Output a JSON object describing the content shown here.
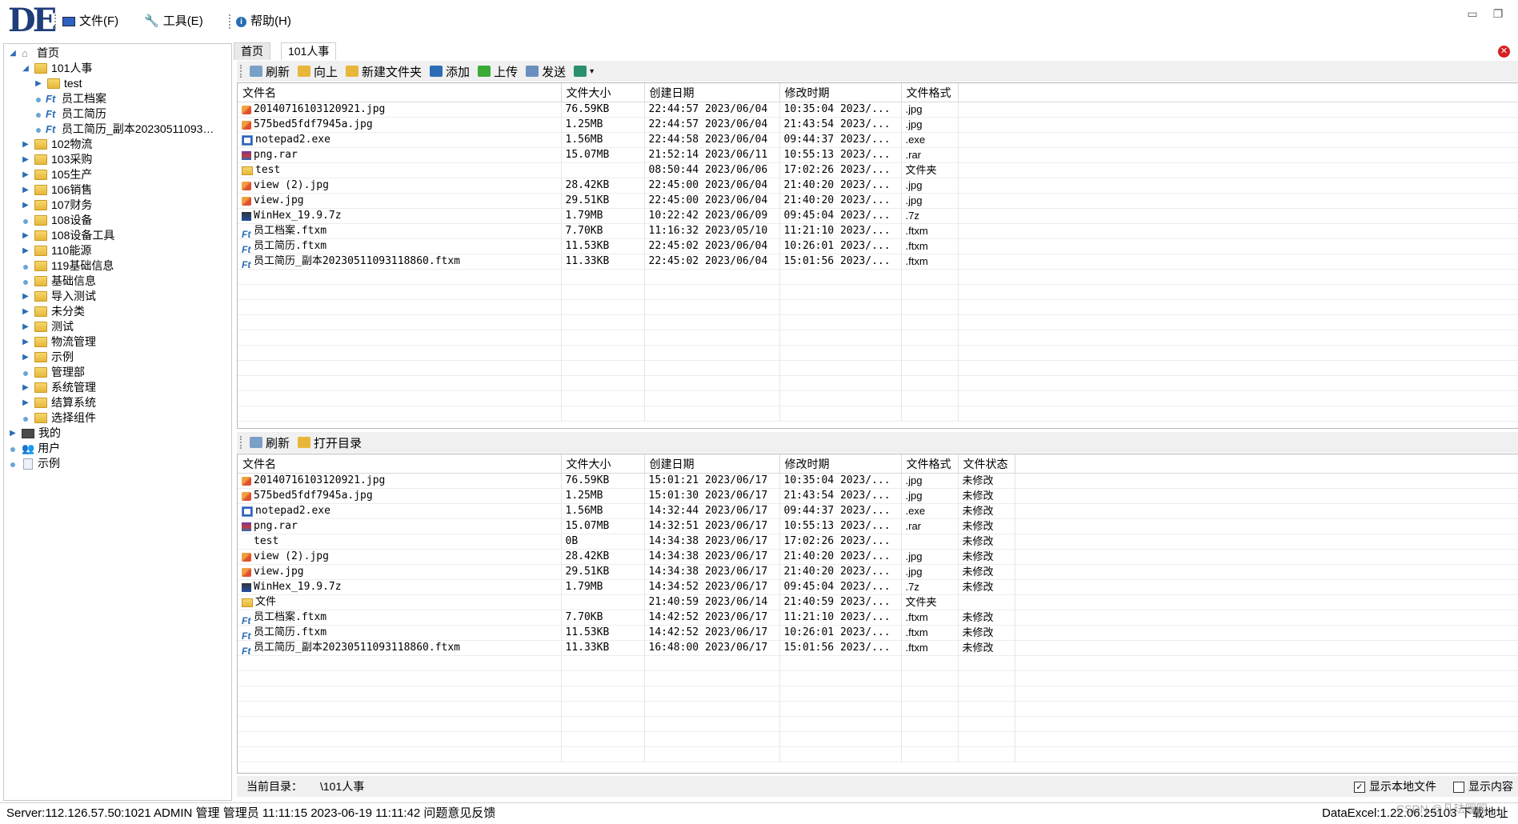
{
  "app": {
    "logo_text": "DE",
    "menu": [
      {
        "label": "文件(F)",
        "icon": "monitor-icon"
      },
      {
        "label": "工具(E)",
        "icon": "wrench-icon"
      },
      {
        "label": "帮助(H)",
        "icon": "info-icon"
      }
    ]
  },
  "tree": {
    "root": "首页",
    "items": [
      {
        "label": "101人事",
        "level": 1,
        "expanded": true,
        "type": "folder"
      },
      {
        "label": "test",
        "level": 2,
        "type": "folder",
        "expandable": true
      },
      {
        "label": "员工档案",
        "level": 2,
        "type": "ft"
      },
      {
        "label": "员工简历",
        "level": 2,
        "type": "ft"
      },
      {
        "label": "员工简历_副本20230511093…",
        "level": 2,
        "type": "ft"
      },
      {
        "label": "102物流",
        "level": 1,
        "type": "folder",
        "expandable": true
      },
      {
        "label": "103采购",
        "level": 1,
        "type": "folder",
        "expandable": true
      },
      {
        "label": "105生产",
        "level": 1,
        "type": "folder",
        "expandable": true
      },
      {
        "label": "106销售",
        "level": 1,
        "type": "folder",
        "expandable": true
      },
      {
        "label": "107财务",
        "level": 1,
        "type": "folder",
        "expandable": true
      },
      {
        "label": "108设备",
        "level": 1,
        "type": "folder",
        "expandable": false
      },
      {
        "label": "108设备工具",
        "level": 1,
        "type": "folder",
        "expandable": true
      },
      {
        "label": "110能源",
        "level": 1,
        "type": "folder",
        "expandable": true
      },
      {
        "label": "119基础信息",
        "level": 1,
        "type": "folder",
        "expandable": false
      },
      {
        "label": "基础信息",
        "level": 1,
        "type": "folder",
        "expandable": false
      },
      {
        "label": "导入测试",
        "level": 1,
        "type": "folder",
        "expandable": true
      },
      {
        "label": "未分类",
        "level": 1,
        "type": "folder",
        "expandable": true
      },
      {
        "label": "测试",
        "level": 1,
        "type": "folder",
        "expandable": true
      },
      {
        "label": "物流管理",
        "level": 1,
        "type": "folder",
        "expandable": true
      },
      {
        "label": "示例",
        "level": 1,
        "type": "folder",
        "expandable": true
      },
      {
        "label": "管理部",
        "level": 1,
        "type": "folder",
        "expandable": false
      },
      {
        "label": "系统管理",
        "level": 1,
        "type": "folder",
        "expandable": true
      },
      {
        "label": "结算系统",
        "level": 1,
        "type": "folder",
        "expandable": true
      },
      {
        "label": "选择组件",
        "level": 1,
        "type": "folder",
        "expandable": false
      },
      {
        "label": "我的",
        "level": 0,
        "type": "pc",
        "expandable": true
      },
      {
        "label": "用户",
        "level": 0,
        "type": "user",
        "expandable": false
      },
      {
        "label": "示例",
        "level": 0,
        "type": "doc",
        "expandable": false
      }
    ]
  },
  "tabs": [
    {
      "label": "首页"
    },
    {
      "label": "101人事"
    }
  ],
  "toolbar_top": [
    {
      "label": "刷新",
      "icon": "refresh-icon",
      "color": "#7aa0c8"
    },
    {
      "label": "向上",
      "icon": "folder-up-icon",
      "color": "#e7b73a"
    },
    {
      "label": "新建文件夹",
      "icon": "new-folder-icon",
      "color": "#e7b73a"
    },
    {
      "label": "添加",
      "icon": "plus-icon",
      "color": "#2a6db5"
    },
    {
      "label": "上传",
      "icon": "upload-arrow-icon",
      "color": "#3aaa35"
    },
    {
      "label": "发送",
      "icon": "send-mail-icon",
      "color": "#6a8fbf"
    },
    {
      "label": "",
      "icon": "image-dropdown-icon",
      "color": "#2a8f6f"
    }
  ],
  "server_grid": {
    "columns": [
      "文件名",
      "文件大小",
      "创建日期",
      "修改时期",
      "文件格式"
    ],
    "rows": [
      {
        "icon": "jpg",
        "name": "20140716103120921.jpg",
        "size": "76.59KB",
        "created": "22:44:57 2023/06/04",
        "modified": "10:35:04 2023/...",
        "format": ".jpg"
      },
      {
        "icon": "jpg",
        "name": "575bed5fdf7945a.jpg",
        "size": "1.25MB",
        "created": "22:44:57 2023/06/04",
        "modified": "21:43:54 2023/...",
        "format": ".jpg"
      },
      {
        "icon": "exe",
        "name": "notepad2.exe",
        "size": "1.56MB",
        "created": "22:44:58 2023/06/04",
        "modified": "09:44:37 2023/...",
        "format": ".exe"
      },
      {
        "icon": "rar",
        "name": "png.rar",
        "size": "15.07MB",
        "created": "21:52:14 2023/06/11",
        "modified": "10:55:13 2023/...",
        "format": ".rar"
      },
      {
        "icon": "folder",
        "name": "test",
        "size": "",
        "created": "08:50:44 2023/06/06",
        "modified": "17:02:26 2023/...",
        "format": "文件夹"
      },
      {
        "icon": "jpg",
        "name": "view (2).jpg",
        "size": "28.42KB",
        "created": "22:45:00 2023/06/04",
        "modified": "21:40:20 2023/...",
        "format": ".jpg"
      },
      {
        "icon": "jpg",
        "name": "view.jpg",
        "size": "29.51KB",
        "created": "22:45:00 2023/06/04",
        "modified": "21:40:20 2023/...",
        "format": ".jpg"
      },
      {
        "icon": "7z",
        "name": "WinHex_19.9.7z",
        "size": "1.79MB",
        "created": "10:22:42 2023/06/09",
        "modified": "09:45:04 2023/...",
        "format": ".7z"
      },
      {
        "icon": "ft",
        "name": "员工档案.ftxm",
        "size": "7.70KB",
        "created": "11:16:32 2023/05/10",
        "modified": "11:21:10 2023/...",
        "format": ".ftxm"
      },
      {
        "icon": "ft",
        "name": "员工简历.ftxm",
        "size": "11.53KB",
        "created": "22:45:02 2023/06/04",
        "modified": "10:26:01 2023/...",
        "format": ".ftxm"
      },
      {
        "icon": "ft",
        "name": "员工简历_副本20230511093118860.ftxm",
        "size": "11.33KB",
        "created": "22:45:02 2023/06/04",
        "modified": "15:01:56 2023/...",
        "format": ".ftxm"
      }
    ]
  },
  "toolbar_bottom": [
    {
      "label": "刷新",
      "icon": "refresh-icon",
      "color": "#7aa0c8"
    },
    {
      "label": "打开目录",
      "icon": "open-folder-icon",
      "color": "#e7b73a"
    }
  ],
  "local_grid": {
    "columns": [
      "文件名",
      "文件大小",
      "创建日期",
      "修改时期",
      "文件格式",
      "文件状态"
    ],
    "rows": [
      {
        "icon": "jpg",
        "name": "20140716103120921.jpg",
        "size": "76.59KB",
        "created": "15:01:21 2023/06/17",
        "modified": "10:35:04 2023/...",
        "format": ".jpg",
        "status": "未修改"
      },
      {
        "icon": "jpg",
        "name": "575bed5fdf7945a.jpg",
        "size": "1.25MB",
        "created": "15:01:30 2023/06/17",
        "modified": "21:43:54 2023/...",
        "format": ".jpg",
        "status": "未修改"
      },
      {
        "icon": "exe",
        "name": "notepad2.exe",
        "size": "1.56MB",
        "created": "14:32:44 2023/06/17",
        "modified": "09:44:37 2023/...",
        "format": ".exe",
        "status": "未修改"
      },
      {
        "icon": "rar",
        "name": "png.rar",
        "size": "15.07MB",
        "created": "14:32:51 2023/06/17",
        "modified": "10:55:13 2023/...",
        "format": ".rar",
        "status": "未修改"
      },
      {
        "icon": "none",
        "name": "test",
        "size": "0B",
        "created": "14:34:38 2023/06/17",
        "modified": "17:02:26 2023/...",
        "format": "",
        "status": "未修改"
      },
      {
        "icon": "jpg",
        "name": "view (2).jpg",
        "size": "28.42KB",
        "created": "14:34:38 2023/06/17",
        "modified": "21:40:20 2023/...",
        "format": ".jpg",
        "status": "未修改"
      },
      {
        "icon": "jpg",
        "name": "view.jpg",
        "size": "29.51KB",
        "created": "14:34:38 2023/06/17",
        "modified": "21:40:20 2023/...",
        "format": ".jpg",
        "status": "未修改"
      },
      {
        "icon": "7z",
        "name": "WinHex_19.9.7z",
        "size": "1.79MB",
        "created": "14:34:52 2023/06/17",
        "modified": "09:45:04 2023/...",
        "format": ".7z",
        "status": "未修改"
      },
      {
        "icon": "folder",
        "name": "文件",
        "size": "",
        "created": "21:40:59 2023/06/14",
        "modified": "21:40:59 2023/...",
        "format": "文件夹",
        "status": ""
      },
      {
        "icon": "ft",
        "name": "员工档案.ftxm",
        "size": "7.70KB",
        "created": "14:42:52 2023/06/17",
        "modified": "11:21:10 2023/...",
        "format": ".ftxm",
        "status": "未修改"
      },
      {
        "icon": "ft",
        "name": "员工简历.ftxm",
        "size": "11.53KB",
        "created": "14:42:52 2023/06/17",
        "modified": "10:26:01 2023/...",
        "format": ".ftxm",
        "status": "未修改"
      },
      {
        "icon": "ft",
        "name": "员工简历_副本20230511093118860.ftxm",
        "size": "11.33KB",
        "created": "16:48:00 2023/06/17",
        "modified": "15:01:56 2023/...",
        "format": ".ftxm",
        "status": "未修改"
      }
    ]
  },
  "current_dir": {
    "label": "当前目录：",
    "value": "\\101人事",
    "show_local_label": "显示本地文件",
    "show_local_checked": true,
    "show_content_label": "显示内容",
    "show_content_checked": false
  },
  "status": {
    "left": "Server:112.126.57.50:1021  ADMIN 管理 管理员 11:11:15 2023-06-19 11:11:42  问题意见反馈",
    "right": "DataExcel:1.22.06.25103  下载地址",
    "watermark": "CSDN @凡珐圈园"
  }
}
